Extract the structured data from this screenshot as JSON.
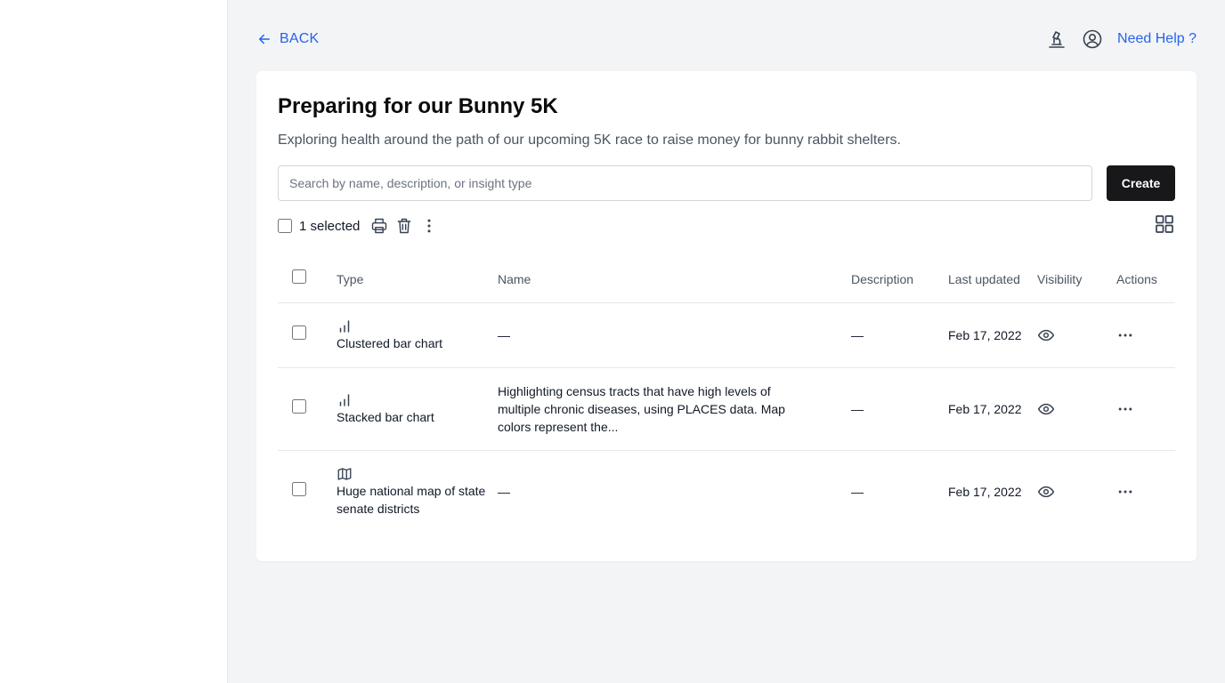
{
  "header": {
    "back_label": "BACK",
    "help_label": "Need Help ?",
    "icons": [
      "microscope-icon",
      "user-circle-icon"
    ]
  },
  "card": {
    "title": "Preparing for our Bunny 5K",
    "subtitle": "Exploring health around the path of our upcoming 5K race to raise money for bunny rabbit shelters.",
    "search_placeholder": "Search by name, description, or insight type",
    "create_label": "Create",
    "selected_label": "1 selected"
  },
  "table": {
    "columns": [
      "Type",
      "Name",
      "Description",
      "Last updated",
      "Visibility",
      "Actions"
    ],
    "rows": [
      {
        "icon": "bar-chart-icon",
        "type": "Clustered bar chart",
        "name": "—",
        "description": "—",
        "updated": "Feb 17, 2022"
      },
      {
        "icon": "bar-chart-icon",
        "type": "Stacked bar chart",
        "name": "Highlighting census tracts that have high levels of multiple chronic diseases, using PLACES data. Map colors represent the...",
        "description": "—",
        "updated": "Feb 17, 2022"
      },
      {
        "icon": "map-icon",
        "type": "Huge national map of state senate districts",
        "name": "—",
        "description": "—",
        "updated": "Feb 17, 2022"
      }
    ]
  },
  "colors": {
    "accent": "#2563eb",
    "button_dark": "#18181b",
    "background": "#f3f4f6"
  }
}
